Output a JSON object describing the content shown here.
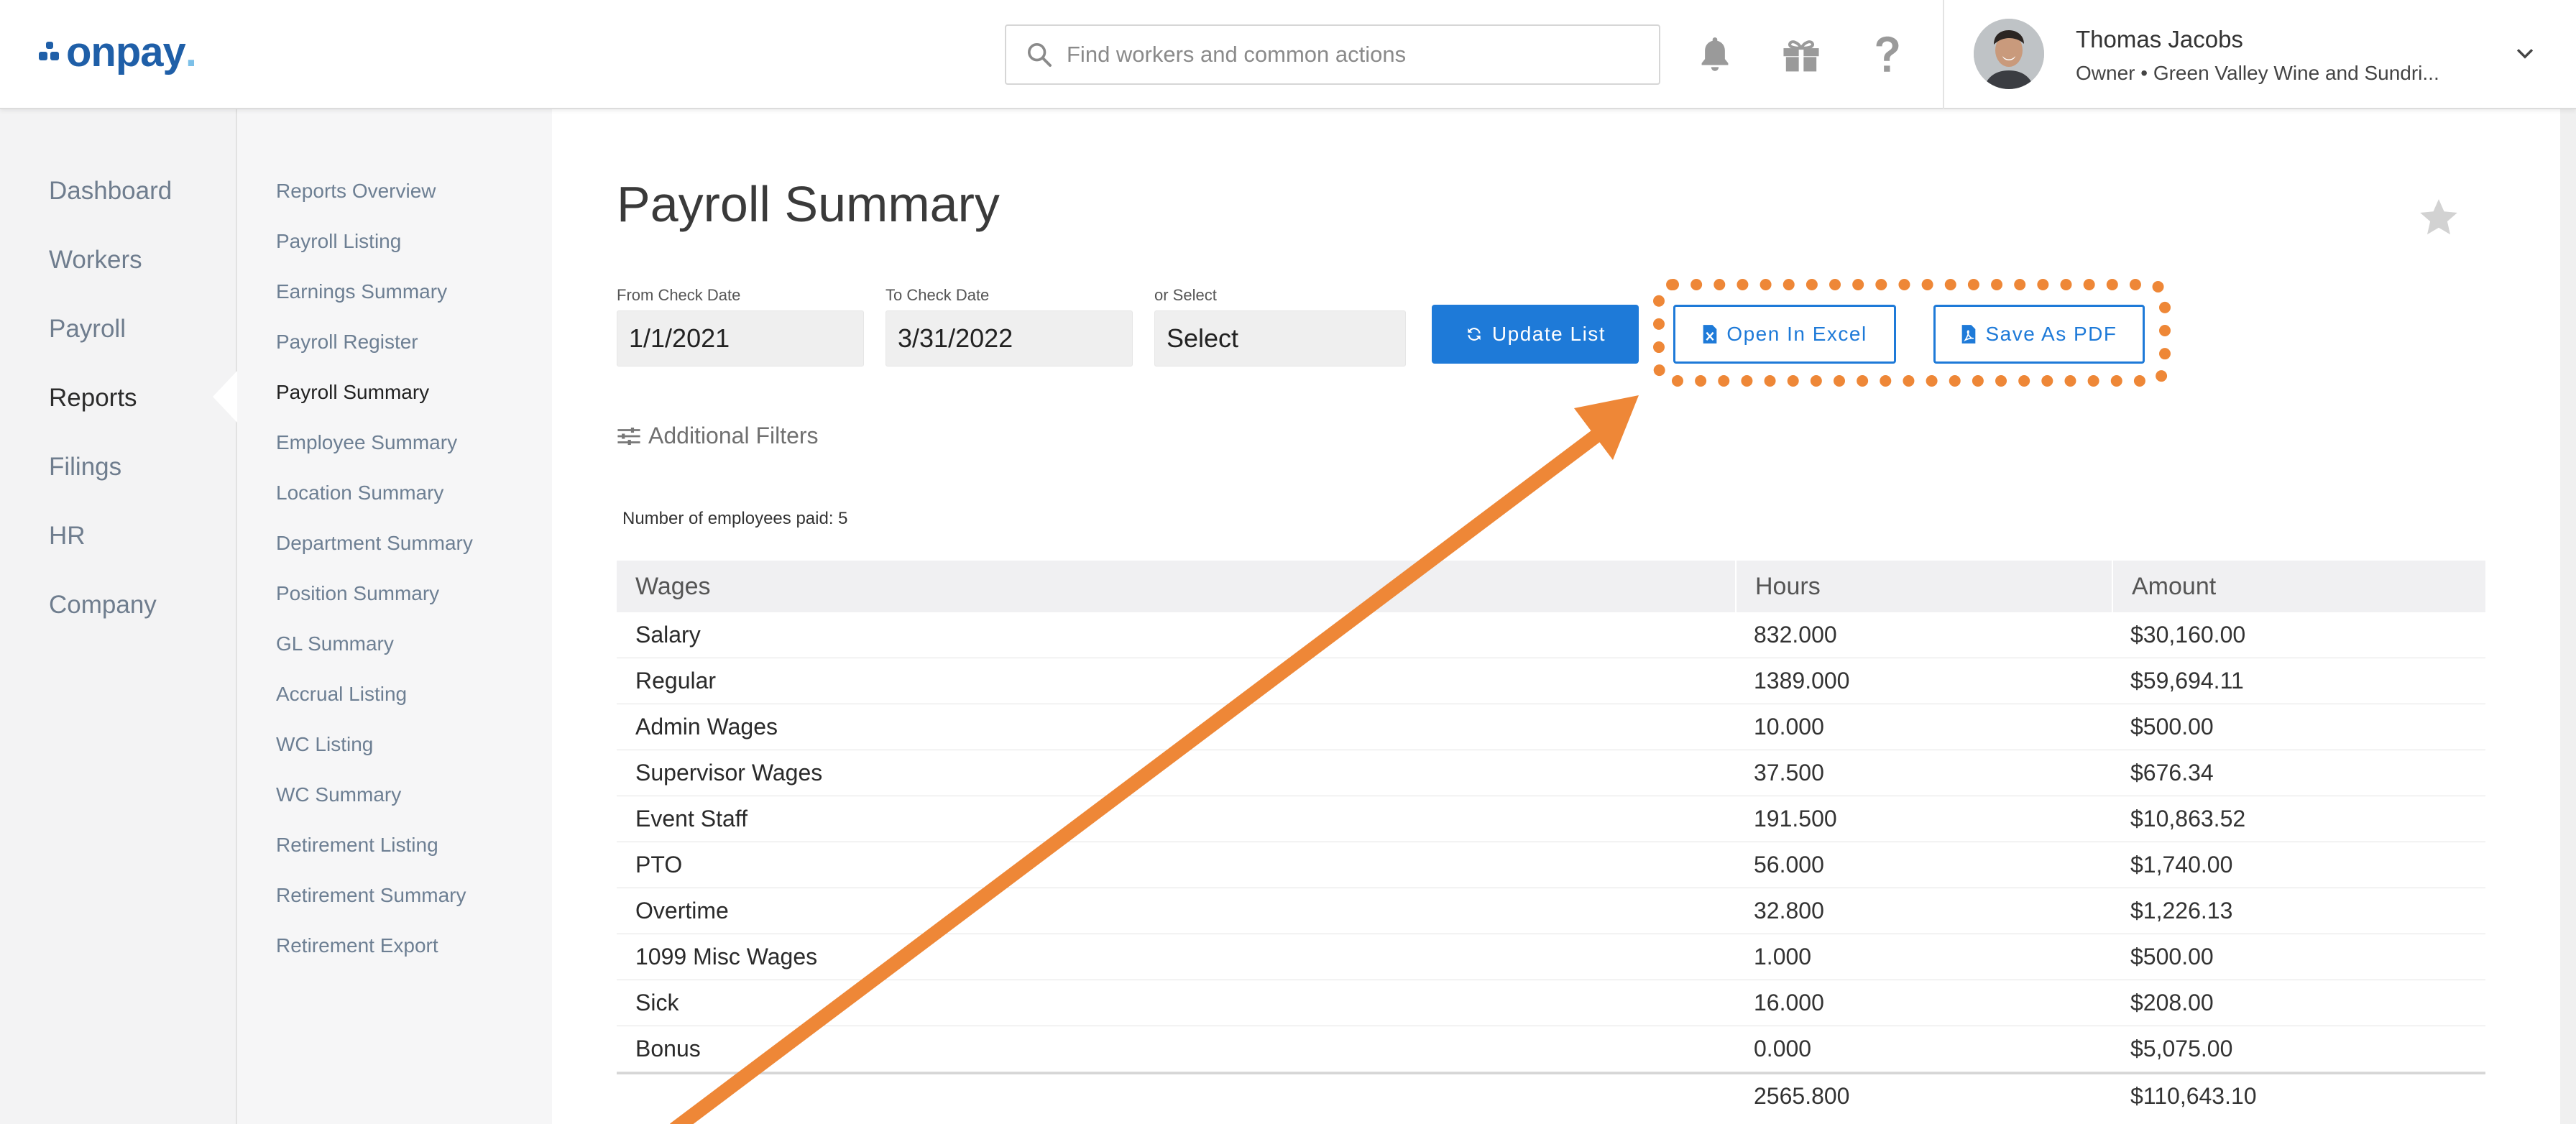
{
  "brand": {
    "logo_text": "onpay",
    "logo_suffix": ".",
    "primary_color": "#1f5fa8",
    "accent_color": "#ee8737"
  },
  "header": {
    "search_placeholder": "Find workers and common actions",
    "user_name": "Thomas Jacobs",
    "user_role": "Owner • Green Valley Wine and Sundri...",
    "icons": [
      "search-icon",
      "bell-icon",
      "gift-icon",
      "help-icon",
      "chevron-down-icon"
    ]
  },
  "nav": {
    "items": [
      {
        "label": "Dashboard",
        "active": false
      },
      {
        "label": "Workers",
        "active": false
      },
      {
        "label": "Payroll",
        "active": false
      },
      {
        "label": "Reports",
        "active": true
      },
      {
        "label": "Filings",
        "active": false
      },
      {
        "label": "HR",
        "active": false
      },
      {
        "label": "Company",
        "active": false
      }
    ]
  },
  "subnav": {
    "items": [
      {
        "label": "Reports Overview",
        "active": false
      },
      {
        "label": "Payroll Listing",
        "active": false
      },
      {
        "label": "Earnings Summary",
        "active": false
      },
      {
        "label": "Payroll Register",
        "active": false
      },
      {
        "label": "Payroll Summary",
        "active": true
      },
      {
        "label": "Employee Summary",
        "active": false
      },
      {
        "label": "Location Summary",
        "active": false
      },
      {
        "label": "Department Summary",
        "active": false
      },
      {
        "label": "Position Summary",
        "active": false
      },
      {
        "label": "GL Summary",
        "active": false
      },
      {
        "label": "Accrual Listing",
        "active": false
      },
      {
        "label": "WC Listing",
        "active": false
      },
      {
        "label": "WC Summary",
        "active": false
      },
      {
        "label": "Retirement Listing",
        "active": false
      },
      {
        "label": "Retirement Summary",
        "active": false
      },
      {
        "label": "Retirement Export",
        "active": false
      }
    ]
  },
  "page": {
    "title": "Payroll Summary",
    "from_label": "From Check Date",
    "from_value": "1/1/2021",
    "to_label": "To Check Date",
    "to_value": "3/31/2022",
    "select_label": "or Select",
    "select_value": "Select",
    "update_button": "Update List",
    "excel_button": "Open In Excel",
    "pdf_button": "Save As PDF",
    "filters_link": "Additional Filters",
    "employee_count": "Number of employees paid: 5"
  },
  "table": {
    "headers": [
      "Wages",
      "Hours",
      "Amount"
    ],
    "rows": [
      [
        "Salary",
        "832.000",
        "$30,160.00"
      ],
      [
        "Regular",
        "1389.000",
        "$59,694.11"
      ],
      [
        "Admin Wages",
        "10.000",
        "$500.00"
      ],
      [
        "Supervisor Wages",
        "37.500",
        "$676.34"
      ],
      [
        "Event Staff",
        "191.500",
        "$10,863.52"
      ],
      [
        "PTO",
        "56.000",
        "$1,740.00"
      ],
      [
        "Overtime",
        "32.800",
        "$1,226.13"
      ],
      [
        "1099 Misc Wages",
        "1.000",
        "$500.00"
      ],
      [
        "Sick",
        "16.000",
        "$208.00"
      ],
      [
        "Bonus",
        "0.000",
        "$5,075.00"
      ]
    ],
    "total": [
      "",
      "2565.800",
      "$110,643.10"
    ]
  }
}
